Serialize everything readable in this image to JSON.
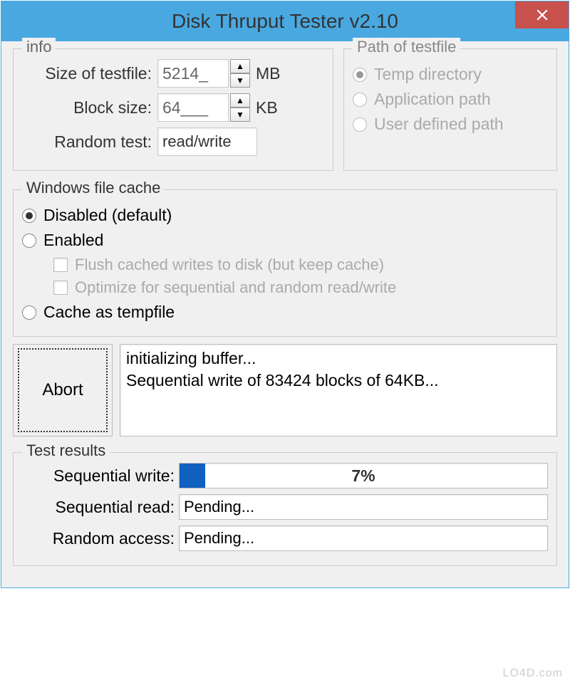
{
  "title": "Disk Thruput Tester v2.10",
  "info": {
    "label": "info",
    "size_label": "Size of testfile:",
    "size_value": "5214_",
    "size_unit": "MB",
    "block_label": "Block size:",
    "block_value": "64___",
    "block_unit": "KB",
    "random_label": "Random test:",
    "random_value": "read/write"
  },
  "path": {
    "label": "Path of testfile",
    "options": [
      {
        "label": "Temp directory",
        "selected": true
      },
      {
        "label": "Application path",
        "selected": false
      },
      {
        "label": "User defined path",
        "selected": false
      }
    ]
  },
  "cache": {
    "label": "Windows file cache",
    "options": [
      {
        "label": "Disabled (default)",
        "selected": true
      },
      {
        "label": "Enabled",
        "selected": false
      },
      {
        "label": "Cache as tempfile",
        "selected": false
      }
    ],
    "checks": [
      {
        "label": "Flush cached writes to disk (but keep cache)"
      },
      {
        "label": "Optimize for sequential and random read/write"
      }
    ]
  },
  "abort_label": "Abort",
  "console": {
    "line1": "initializing buffer...",
    "line2": "Sequential write of 83424 blocks of 64KB..."
  },
  "results": {
    "label": "Test results",
    "seq_write_label": "Sequential write:",
    "seq_write_percent": 7,
    "seq_write_text": "7%",
    "seq_read_label": "Sequential read:",
    "seq_read_value": "Pending...",
    "random_label": "Random access:",
    "random_value": "Pending..."
  },
  "watermark": "LO4D.com"
}
